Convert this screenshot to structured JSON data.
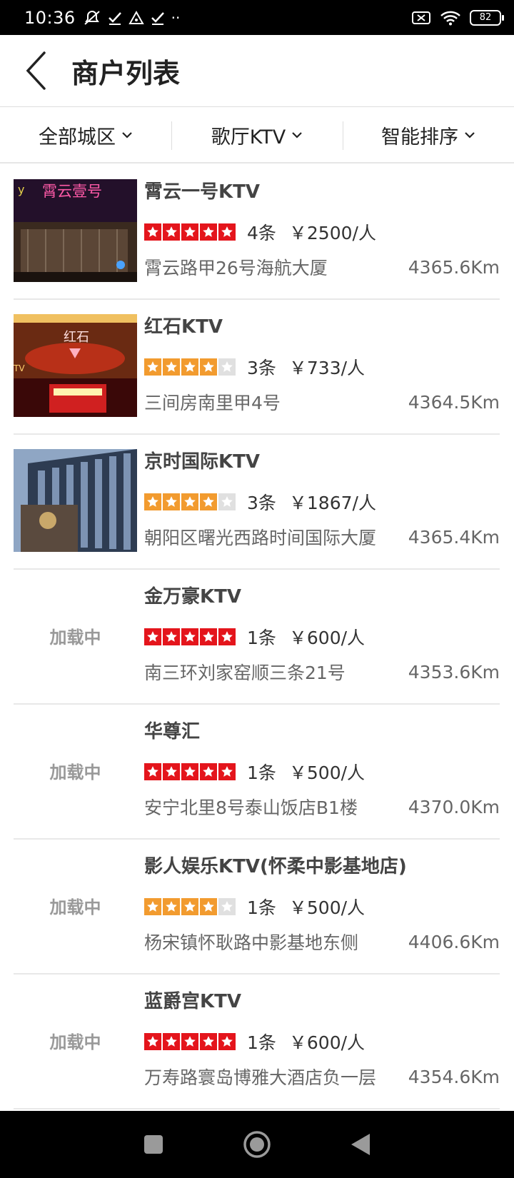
{
  "status_bar": {
    "time": "10:36",
    "dots": "··",
    "battery": "82"
  },
  "header": {
    "title": "商户列表"
  },
  "filters": [
    {
      "label": "全部城区"
    },
    {
      "label": "歌厅KTV"
    },
    {
      "label": "智能排序"
    }
  ],
  "loading_text": "加载中",
  "colors": {
    "star_red": "#e4151c",
    "star_orange": "#f29b2f",
    "star_empty": "#e0e0e0"
  },
  "items": [
    {
      "name": "霄云一号KTV",
      "rating": 5,
      "star_color": "red",
      "count": "4条",
      "price": "￥2500/人",
      "address": "霄云路甲26号海航大厦",
      "distance": "4365.6Km",
      "image": "photo",
      "sign_text": "霄云壹号"
    },
    {
      "name": "红石KTV",
      "rating": 4,
      "star_color": "orange",
      "count": "3条",
      "price": "￥733/人",
      "address": "三间房南里甲4号",
      "distance": "4364.5Km",
      "image": "photo",
      "sign_text": "红石"
    },
    {
      "name": "京时国际KTV",
      "rating": 4,
      "star_color": "orange",
      "count": "3条",
      "price": "￥1867/人",
      "address": "朝阳区曙光西路时间国际大厦",
      "distance": "4365.4Km",
      "image": "photo"
    },
    {
      "name": "金万豪KTV",
      "rating": 5,
      "star_color": "red",
      "count": "1条",
      "price": "￥600/人",
      "address": "南三环刘家窑顺三条21号",
      "distance": "4353.6Km",
      "image": "loading"
    },
    {
      "name": "华尊汇",
      "rating": 5,
      "star_color": "red",
      "count": "1条",
      "price": "￥500/人",
      "address": "安宁北里8号泰山饭店B1楼",
      "distance": "4370.0Km",
      "image": "loading"
    },
    {
      "name": "影人娱乐KTV(怀柔中影基地店)",
      "rating": 4,
      "star_color": "orange",
      "count": "1条",
      "price": "￥500/人",
      "address": "杨宋镇怀耿路中影基地东侧",
      "distance": "4406.6Km",
      "image": "loading"
    },
    {
      "name": "蓝爵宫KTV",
      "rating": 5,
      "star_color": "red",
      "count": "1条",
      "price": "￥600/人",
      "address": "万寿路寰岛博雅大酒店负一层",
      "distance": "4354.6Km",
      "image": "loading"
    }
  ]
}
